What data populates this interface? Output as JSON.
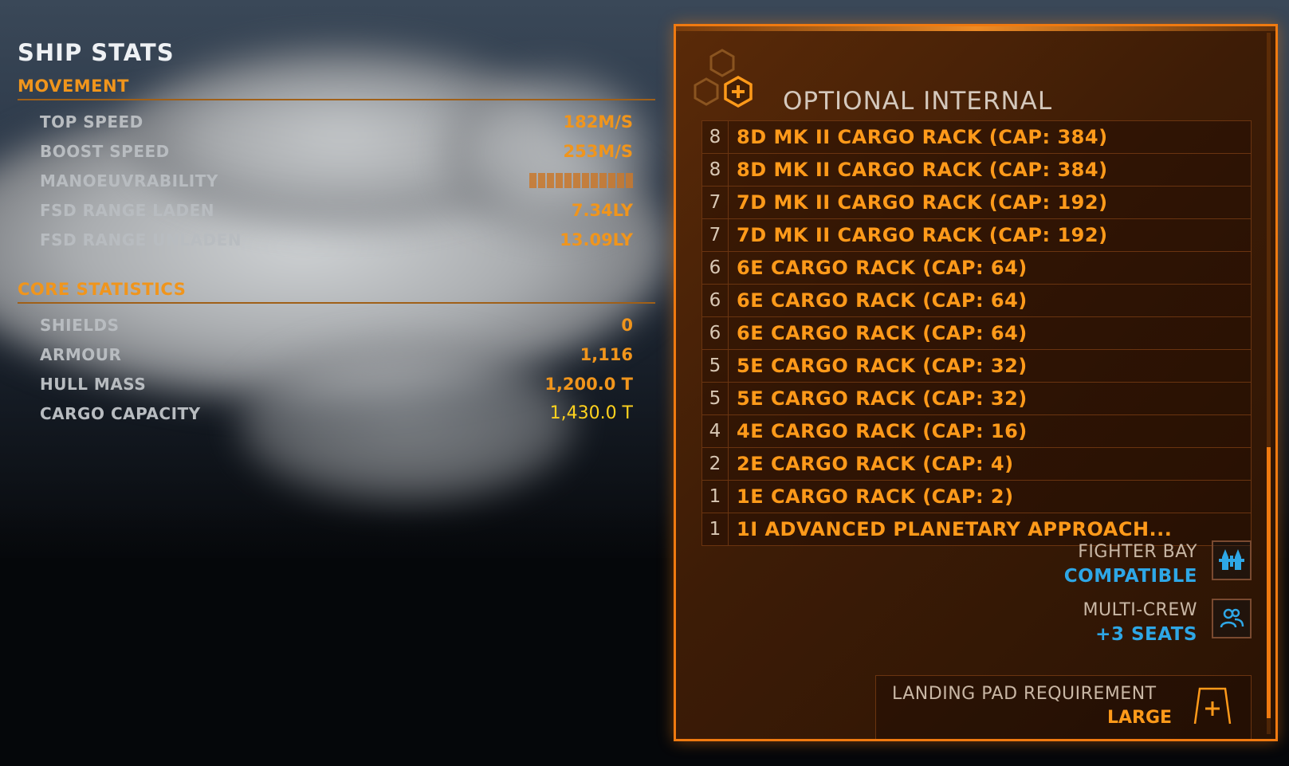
{
  "ship_stats": {
    "title": "SHIP STATS",
    "movement": {
      "heading": "MOVEMENT",
      "rows": [
        {
          "label": "TOP SPEED",
          "value": "182M/S"
        },
        {
          "label": "BOOST SPEED",
          "value": "253M/S"
        },
        {
          "label": "MANOEUVRABILITY",
          "value": "",
          "bar_segments": 12
        },
        {
          "label": "FSD RANGE LADEN",
          "value": "7.34LY"
        },
        {
          "label": "FSD RANGE UNLADEN",
          "value": "13.09LY"
        }
      ]
    },
    "core": {
      "heading": "CORE STATISTICS",
      "rows": [
        {
          "label": "SHIELDS",
          "value": "0"
        },
        {
          "label": "ARMOUR",
          "value": "1,116"
        },
        {
          "label": "HULL MASS",
          "value": "1,200.0 T"
        },
        {
          "label": "CARGO CAPACITY",
          "value": "1,430.0 T"
        }
      ]
    }
  },
  "optional_internal": {
    "title": "OPTIONAL INTERNAL",
    "icon": "hexagon-plus-icon",
    "modules": [
      {
        "size": "8",
        "name": "8D MK II CARGO RACK (CAP: 384)"
      },
      {
        "size": "8",
        "name": "8D MK II CARGO RACK (CAP: 384)"
      },
      {
        "size": "7",
        "name": "7D MK II CARGO RACK (CAP: 192)"
      },
      {
        "size": "7",
        "name": "7D MK II CARGO RACK (CAP: 192)"
      },
      {
        "size": "6",
        "name": "6E CARGO RACK (CAP: 64)"
      },
      {
        "size": "6",
        "name": "6E CARGO RACK (CAP: 64)"
      },
      {
        "size": "6",
        "name": "6E CARGO RACK (CAP: 64)"
      },
      {
        "size": "5",
        "name": "5E CARGO RACK (CAP: 32)"
      },
      {
        "size": "5",
        "name": "5E CARGO RACK (CAP: 32)"
      },
      {
        "size": "4",
        "name": "4E CARGO RACK (CAP: 16)"
      },
      {
        "size": "2",
        "name": "2E CARGO RACK (CAP: 4)"
      },
      {
        "size": "1",
        "name": "1E CARGO RACK (CAP: 2)"
      },
      {
        "size": "1",
        "name": "1I ADVANCED PLANETARY APPROACH..."
      }
    ],
    "fighter_bay": {
      "label": "FIGHTER BAY",
      "value": "COMPATIBLE",
      "icon": "fighter-icon"
    },
    "multi_crew": {
      "label": "MULTI-CREW",
      "value": "+3 SEATS",
      "icon": "crew-icon"
    },
    "landing_pad": {
      "label": "LANDING PAD REQUIREMENT",
      "value": "LARGE",
      "icon": "landing-pad-icon"
    }
  },
  "colors": {
    "accent_orange": "#f07a10",
    "value_orange": "#f0951c",
    "info_blue": "#2ea7e6",
    "highlight_yellow": "#ffd21e"
  }
}
